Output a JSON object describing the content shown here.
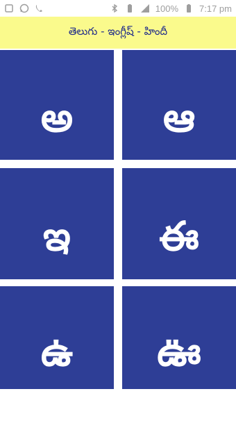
{
  "status_bar": {
    "left_icons": [
      "notification-icon",
      "whatsapp-icon",
      "phone-icon"
    ],
    "right_icons": [
      "bluetooth-icon",
      "battery-saver-icon",
      "signal-icon"
    ],
    "battery": "100%",
    "time": "7:17 pm"
  },
  "title": "తెలుగు - ఇంగ్లీష్ - హిందీ",
  "tiles": [
    {
      "letter": "అ"
    },
    {
      "letter": "ఆ"
    },
    {
      "letter": "ఇ"
    },
    {
      "letter": "ఈ"
    },
    {
      "letter": "ఉ"
    },
    {
      "letter": "ఊ"
    }
  ],
  "colors": {
    "title_background": "#fafa8c",
    "title_text": "#1e2a8a",
    "tile_background": "#2e3e96",
    "tile_text": "#ffffff"
  }
}
